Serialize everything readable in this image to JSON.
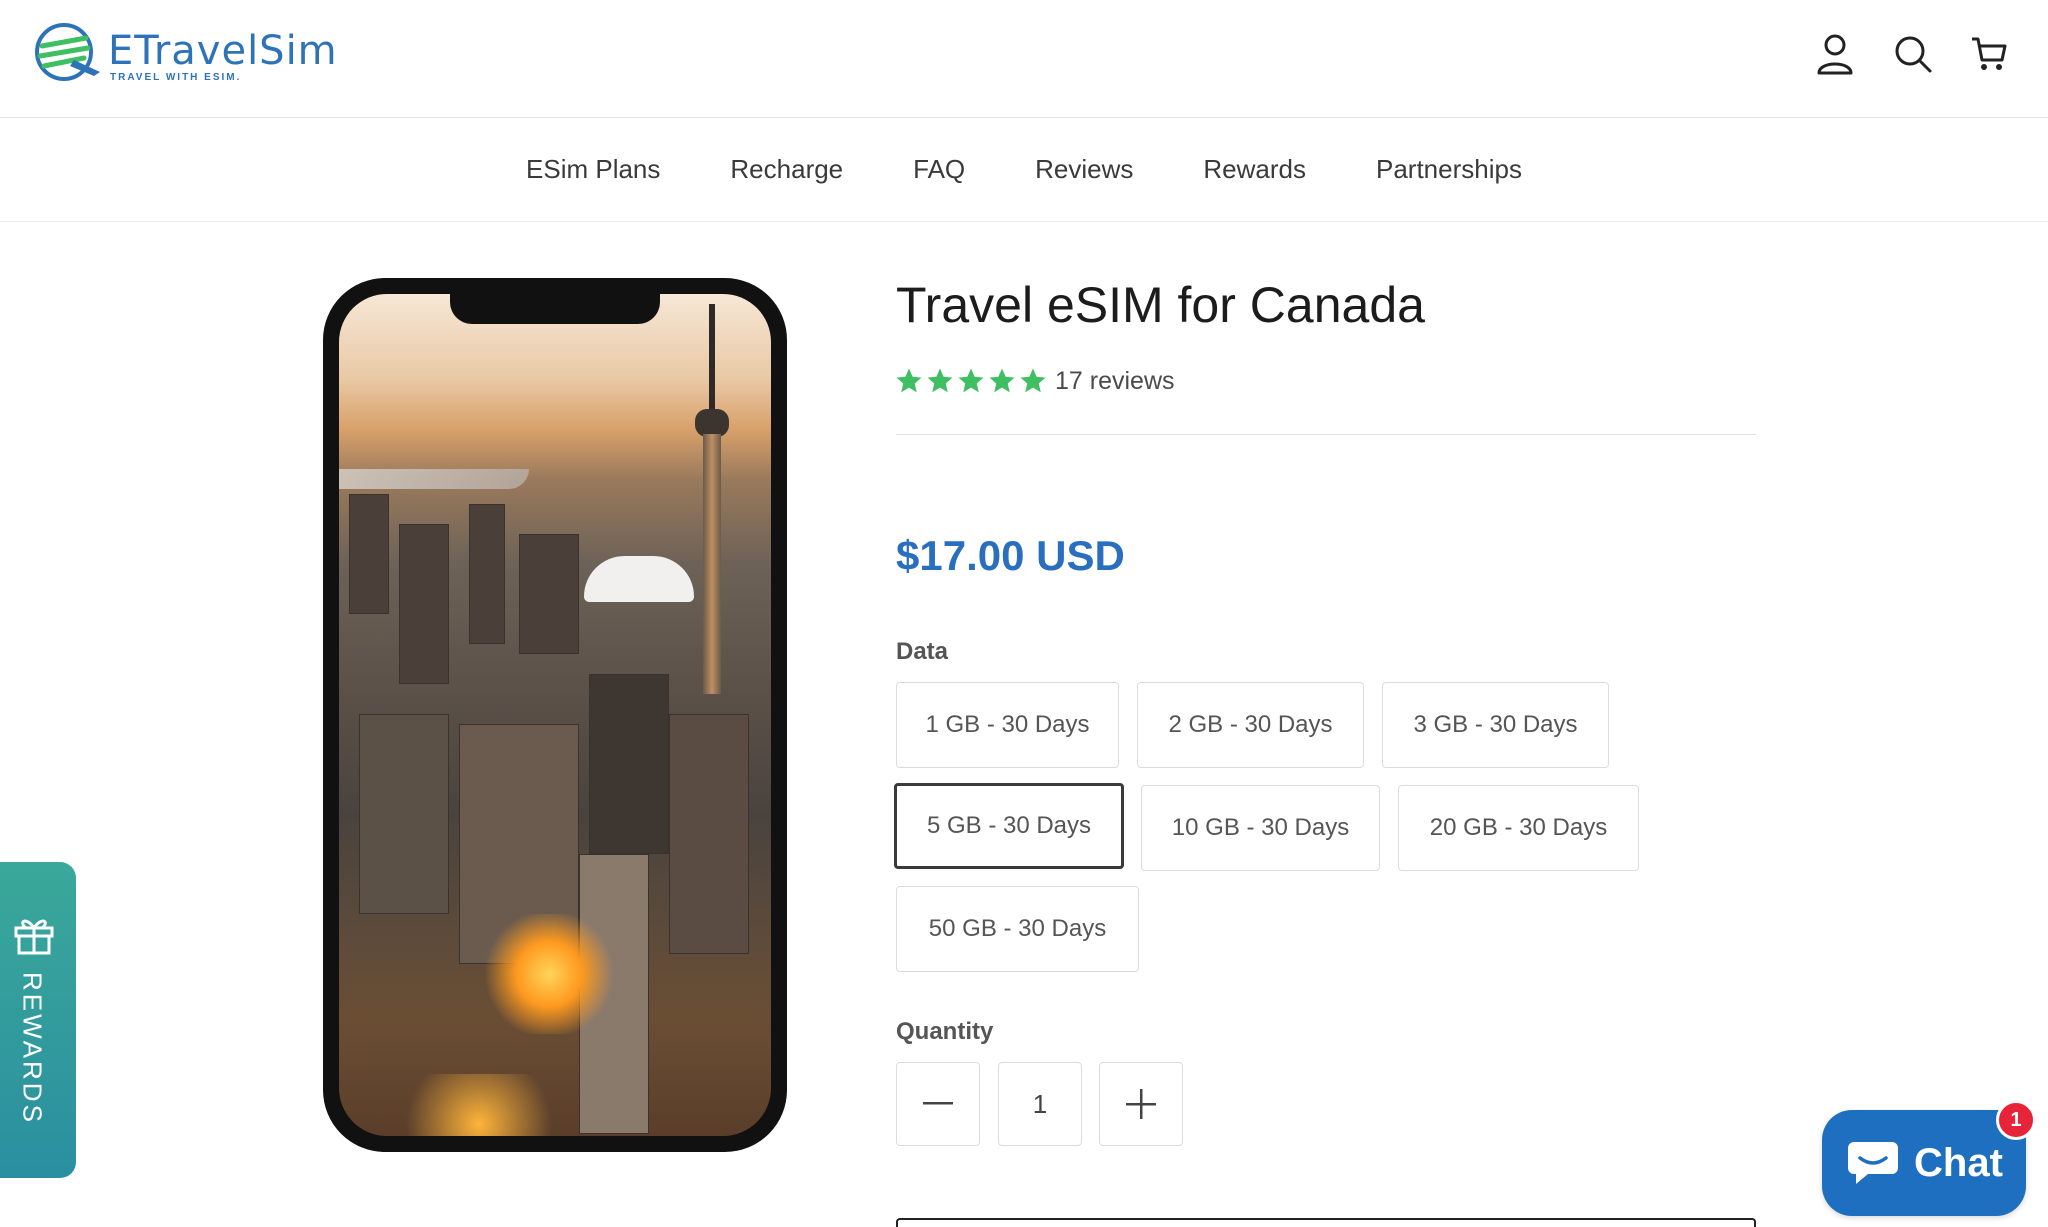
{
  "brand": {
    "name": "ETravelSim",
    "tagline": "TRAVEL WITH ESIM."
  },
  "header_icons": [
    "account-icon",
    "search-icon",
    "cart-icon"
  ],
  "nav": {
    "items": [
      {
        "label": "ESim Plans"
      },
      {
        "label": "Recharge"
      },
      {
        "label": "FAQ"
      },
      {
        "label": "Reviews"
      },
      {
        "label": "Rewards"
      },
      {
        "label": "Partnerships"
      }
    ]
  },
  "product": {
    "title": "Travel eSIM for Canada",
    "rating": 5,
    "reviews_label": "17 reviews",
    "price": "$17.00 USD",
    "data_label": "Data",
    "options": [
      {
        "label": "1 GB - 30 Days",
        "selected": false
      },
      {
        "label": "2 GB - 30 Days",
        "selected": false
      },
      {
        "label": "3 GB - 30 Days",
        "selected": false
      },
      {
        "label": "5 GB - 30 Days",
        "selected": true
      },
      {
        "label": "10 GB - 30 Days",
        "selected": false
      },
      {
        "label": "20 GB - 30 Days",
        "selected": false
      },
      {
        "label": "50 GB - 30 Days",
        "selected": false
      }
    ],
    "quantity_label": "Quantity",
    "quantity": "1"
  },
  "rewards_tab": {
    "label": "REWARDS"
  },
  "chat": {
    "label": "Chat",
    "badge": "1"
  },
  "colors": {
    "price": "#2a6ec0",
    "star": "#3fbf62",
    "chat_bg": "#1f6fc0",
    "badge": "#e8243a",
    "rewards_bg": "#3aa89a"
  }
}
